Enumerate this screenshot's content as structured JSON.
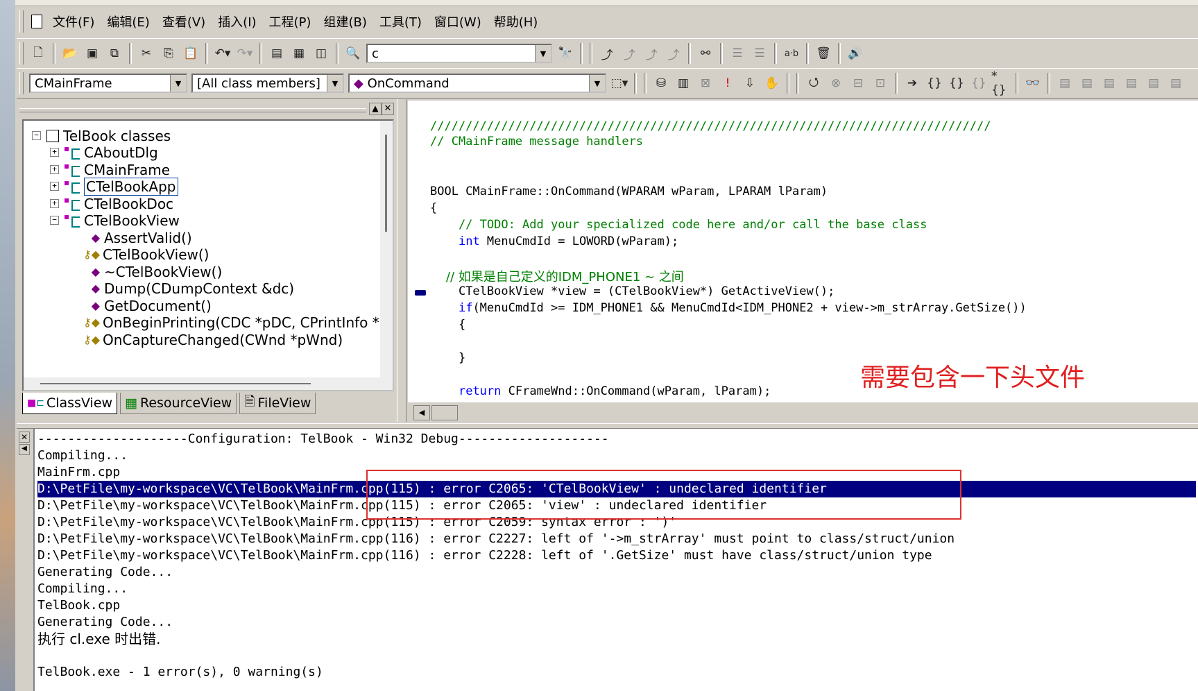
{
  "menu": [
    "文件(F)",
    "编辑(E)",
    "查看(V)",
    "插入(I)",
    "工程(P)",
    "组建(B)",
    "工具(T)",
    "窗口(W)",
    "帮助(H)"
  ],
  "toolbar1": {
    "find_combo_value": "c"
  },
  "toolbar2": {
    "class_combo": "CMainFrame",
    "filter_combo": "[All class members]",
    "member_combo": "OnCommand"
  },
  "classview": {
    "root": "TelBook classes",
    "classes": [
      "CAboutDlg",
      "CMainFrame",
      "CTelBookApp",
      "CTelBookDoc",
      "CTelBookView"
    ],
    "members": [
      "AssertValid()",
      "CTelBookView()",
      "~CTelBookView()",
      "Dump(CDumpContext &dc)",
      "GetDocument()",
      "OnBeginPrinting(CDC *pDC, CPrintInfo *",
      "OnCaptureChanged(CWnd *pWnd)"
    ]
  },
  "tabs": [
    "ClassView",
    "ResourceView",
    "FileView"
  ],
  "editor": {
    "line1": "///////////////////////////////////////////////////////////////////////////////",
    "line2": "// CMainFrame message handlers",
    "line3": "BOOL CMainFrame::OnCommand(WPARAM wParam, LPARAM lParam)",
    "line4": "{",
    "line5": "    // TODO: Add your specialized code here and/or call the base class",
    "line6_kw": "int",
    "line6_rest": " MenuCmdId = LOWORD(wParam);",
    "line7": "    // 如果是自己定义的IDM_PHONE1 ~ 之间",
    "line8": "    CTelBookView *view = (CTelBookView*) GetActiveView();",
    "line9_kw": "if",
    "line9_rest": "(MenuCmdId >= IDM_PHONE1 && MenuCmdId<IDM_PHONE2 + view->m_strArray.GetSize())",
    "line10": "    {",
    "line11": "    }",
    "line12_kw": "return",
    "line12_rest": " CFrameWnd::OnCommand(wParam, lParam);",
    "annotation": "需要包含一下头文件"
  },
  "output": [
    "--------------------Configuration: TelBook - Win32 Debug--------------------",
    "Compiling...",
    "MainFrm.cpp",
    "D:\\PetFile\\my-workspace\\VC\\TelBook\\MainFrm.cpp(115) : error C2065: 'CTelBookView' : undeclared identifier",
    "D:\\PetFile\\my-workspace\\VC\\TelBook\\MainFrm.cpp(115) : error C2065: 'view' : undeclared identifier",
    "D:\\PetFile\\my-workspace\\VC\\TelBook\\MainFrm.cpp(115) : error C2059: syntax error : ')'",
    "D:\\PetFile\\my-workspace\\VC\\TelBook\\MainFrm.cpp(116) : error C2227: left of '->m_strArray' must point to class/struct/union",
    "D:\\PetFile\\my-workspace\\VC\\TelBook\\MainFrm.cpp(116) : error C2228: left of '.GetSize' must have class/struct/union type",
    "Generating Code...",
    "Compiling...",
    "TelBook.cpp",
    "Generating Code...",
    "执行 cl.exe 时出错.",
    "",
    "TelBook.exe - 1 error(s), 0 warning(s)"
  ]
}
